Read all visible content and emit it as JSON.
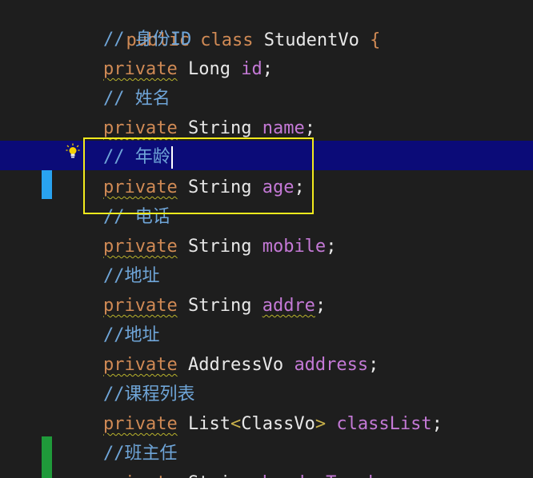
{
  "lines": [
    {
      "kw1": "public",
      "kw2": "class",
      "name": "StudentVo",
      "brace": "{"
    },
    {
      "comment": "// 身份ID"
    },
    {
      "kw": "private",
      "type": "Long",
      "field": "id",
      "semi": ";"
    },
    {
      "comment": "// 姓名"
    },
    {
      "kw": "private",
      "type": "String",
      "field": "name",
      "semi": ";"
    },
    {
      "comment": "// 年龄"
    },
    {
      "kw": "private",
      "type": "String",
      "field": "age",
      "semi": ";"
    },
    {
      "comment": "// 电话"
    },
    {
      "kw": "private",
      "type": "String",
      "field": "mobile",
      "semi": ";"
    },
    {
      "comment": "//地址"
    },
    {
      "kw": "private",
      "type": "String",
      "field": "addre",
      "semi": ";"
    },
    {
      "comment": "//地址"
    },
    {
      "kw": "private",
      "type": "AddressVo",
      "field": "address",
      "semi": ";"
    },
    {
      "comment": "//课程列表"
    },
    {
      "kw": "private",
      "type": "List",
      "lt": "<",
      "generic": "ClassVo",
      "gt": ">",
      "field": "classList",
      "semi": ";"
    },
    {
      "comment": "//班主任"
    },
    {
      "kw": "private",
      "type": "String",
      "field": "headerTeacher",
      "semi": ";"
    }
  ],
  "colors": {
    "background": "#1e1e1e",
    "current_line": "#0b0b78",
    "keyword": "#d08a55",
    "comment": "#6fa5d8",
    "field": "#c479d6",
    "highlight_box": "#f2ea1d",
    "change_marker_blue": "#29a3f0",
    "change_marker_green": "#1f9a3a"
  },
  "icons": {
    "lightbulb": "lightbulb-icon"
  }
}
